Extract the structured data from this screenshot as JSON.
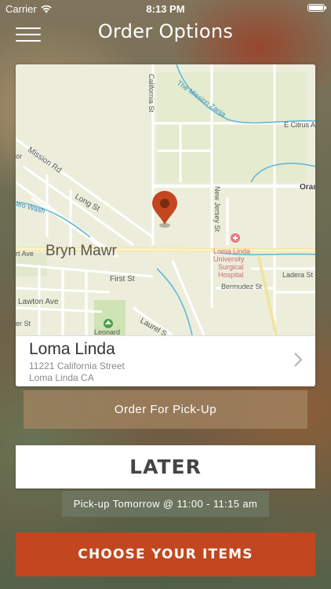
{
  "status_bar": {
    "carrier": "Carrier",
    "time": "8:13 PM",
    "wifi_icon": "wifi-icon",
    "battery_icon": "battery-icon"
  },
  "header": {
    "title": "Order Options",
    "menu_icon": "hamburger-menu-icon"
  },
  "map": {
    "labels": {
      "mission_rd": "Mission Rd",
      "long_st": "Long St",
      "bryn_mawr": "Bryn Mawr",
      "first_st": "First St",
      "lawton_ave": "Lawton Ave",
      "laurel": "Laurel S",
      "leonard": "Leonard",
      "california_st": "California St",
      "mission_zanja": "The Mission Zanja",
      "e_citrus": "E Citrus A",
      "orange": "Oran",
      "new_jersey": "New Jersey St",
      "hospital": "Loma Linda University Surgical Hospital",
      "hospital_lines": [
        "Loma Linda",
        "University",
        "Surgical",
        "Hospital"
      ],
      "ladera": "Ladera St",
      "bermudez": "Bermudez St",
      "rt_ave": "rt Ave",
      "er_st": "er St",
      "or": "or",
      "teo_wash": "teo Wash"
    },
    "pin_icon": "map-pin-icon",
    "colors": {
      "water": "#64b8d8",
      "road": "#ffffff",
      "main_road": "#f6e9a8",
      "park": "#cfe3b4",
      "hospital": "#e07a8a"
    }
  },
  "location": {
    "name": "Loma Linda",
    "address_line1": "11221 California Street",
    "address_line2": "Loma Linda CA",
    "chevron_icon": "chevron-right-icon"
  },
  "actions": {
    "pickup_label": "Order For Pick-Up",
    "later_label": "LATER",
    "pickup_time": "Pick-up Tomorrow @ 11:00 - 11:15 am",
    "choose_label": "CHOOSE YOUR ITEMS"
  },
  "colors": {
    "accent": "#c2471f"
  }
}
